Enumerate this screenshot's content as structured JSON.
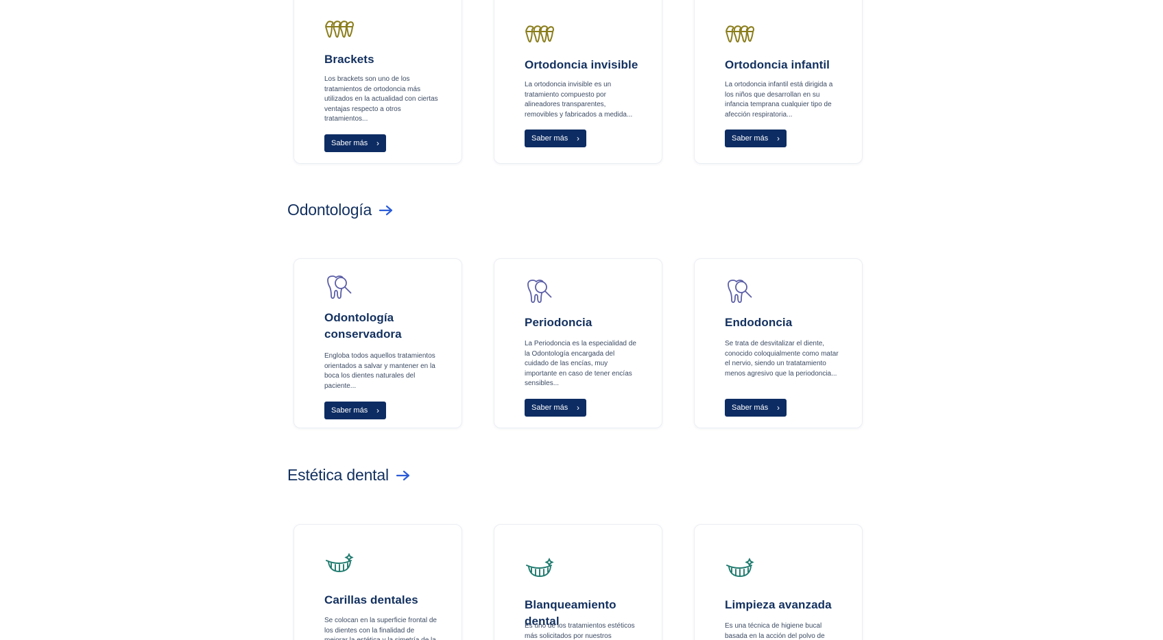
{
  "sections": {
    "ortodoncia": {
      "cards": [
        {
          "title": "Brackets",
          "desc": "Los brackets son uno de los tratamientos de ortodoncia más utilizados en la actualidad con ciertas ventajas respecto a otros tratamientos...",
          "button": "Saber más",
          "icon": "teeth-braces-icon"
        },
        {
          "title": "Ortodoncia invisible",
          "desc": "La ortodoncia invisible es un tratamiento compuesto por alineadores transparentes, removibles y fabricados a medida...",
          "button": "Saber más",
          "icon": "teeth-braces-icon"
        },
        {
          "title": "Ortodoncia infantil",
          "desc": "La ortodoncia infantil está dirigida a los niños que desarrollan en su infancia temprana cualquier tipo de afección respiratoria...",
          "button": "Saber más",
          "icon": "teeth-braces-icon"
        }
      ]
    },
    "odontologia": {
      "heading": "Odontología",
      "cards": [
        {
          "title": "Odontología conservadora",
          "desc": "Engloba todos aquellos tratamientos orientados a salvar y mantener en la boca los dientes naturales del paciente...",
          "button": "Saber más",
          "icon": "tooth-magnifier-icon"
        },
        {
          "title": "Periodoncia",
          "desc": "La Periodoncia es la especialidad de la Odontología encargada del cuidado de las encías, muy importante en caso de tener encías sensibles...",
          "button": "Saber más",
          "icon": "tooth-magnifier-icon"
        },
        {
          "title": "Endodoncia",
          "desc": "Se trata de desvitalizar el diente, conocido coloquialmente como matar el nervio, siendo un tratatamiento menos agresivo que la periodoncia...",
          "button": "Saber más",
          "icon": "tooth-magnifier-icon"
        }
      ]
    },
    "estetica": {
      "heading": "Estética dental",
      "cards": [
        {
          "title": "Carillas dentales",
          "desc": "Se colocan en la superficie frontal de los dientes con la finalidad de mejorar la estética y la simetría de la sonrisa...",
          "icon": "smile-sparkle-icon"
        },
        {
          "title": "Blanqueamiento dental",
          "desc": "Es uno de los tratamientos estéticos más solicitados por nuestros pacientes en clínica...",
          "icon": "smile-sparkle-icon"
        },
        {
          "title": "Limpieza avanzada",
          "desc": "Es una técnica de higiene bucal basada en la acción del polvo de bicarbonato de sodio...",
          "icon": "smile-sparkle-icon"
        }
      ]
    }
  },
  "colors": {
    "navy": "#0d2c63",
    "heading": "#12305f",
    "arrow": "#2a5bd7",
    "icon_gold": "#8a7d1c",
    "icon_purple": "#5b5ea6",
    "icon_teal": "#1f7a6e"
  }
}
